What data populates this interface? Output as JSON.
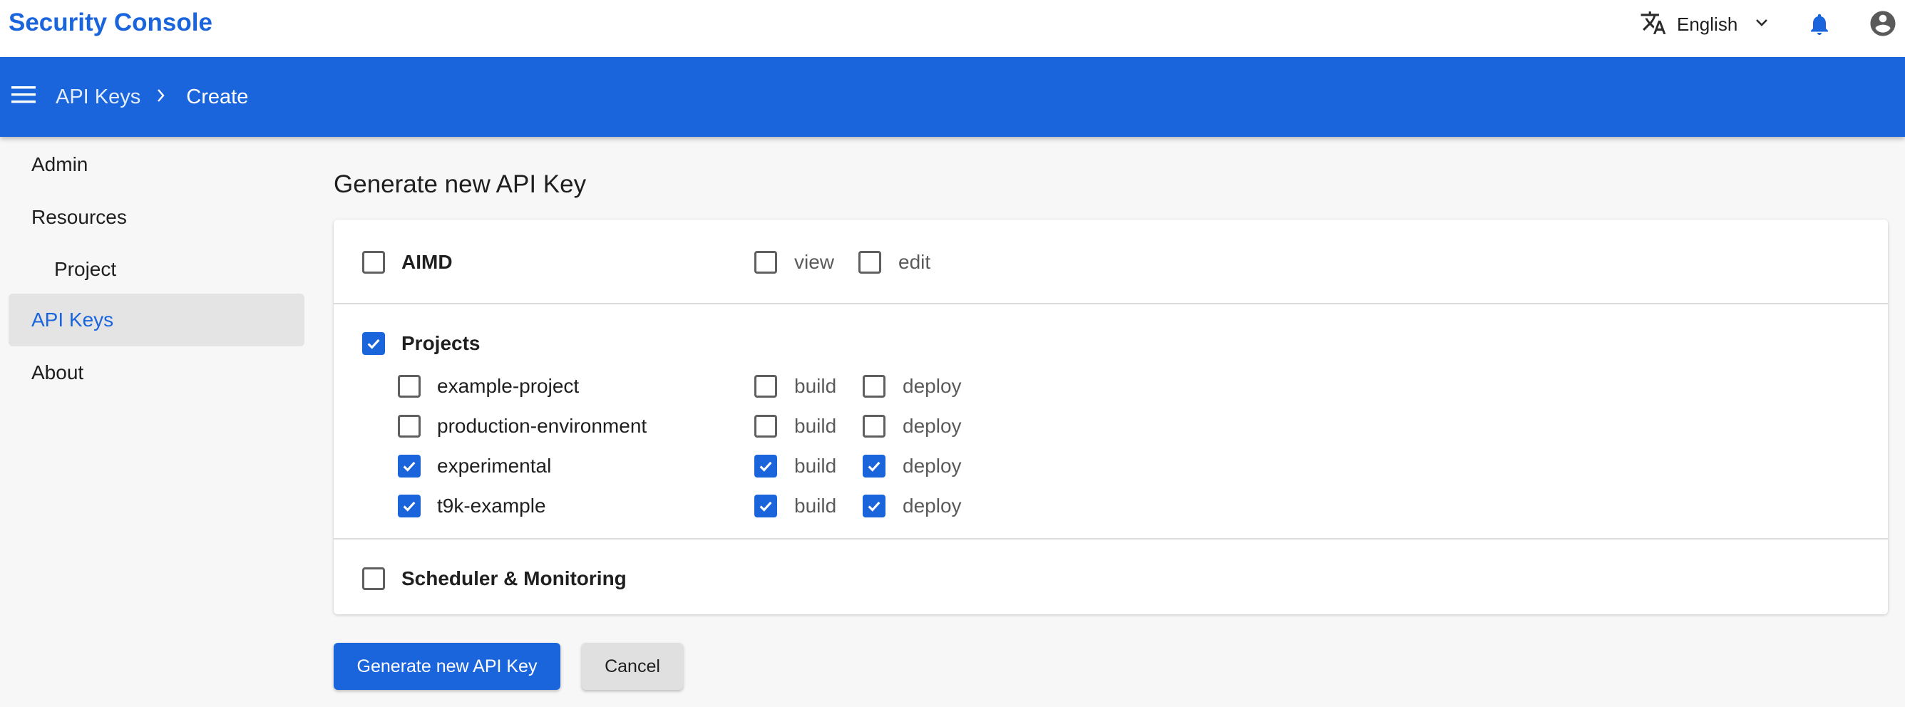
{
  "app": {
    "title": "Security Console"
  },
  "topbar": {
    "language_icon": "translate-icon",
    "language": "English",
    "language_chevron_icon": "chevron-down-icon",
    "notifications_icon": "bell-icon",
    "account_icon": "account-circle-icon"
  },
  "header": {
    "menu_icon": "hamburger-menu-icon",
    "breadcrumb": [
      "API Keys",
      "Create"
    ],
    "separator_icon": "chevron-right-icon"
  },
  "sidebar": {
    "items": [
      {
        "label": "Admin",
        "active": false
      },
      {
        "label": "Resources",
        "active": false
      },
      {
        "label": "Project",
        "active": false,
        "sub": true
      },
      {
        "label": "API Keys",
        "active": true
      },
      {
        "label": "About",
        "active": false
      }
    ]
  },
  "main": {
    "title": "Generate new API Key",
    "groups": {
      "aimd": {
        "label": "AIMD",
        "checked": false,
        "perms": [
          {
            "label": "view",
            "checked": false
          },
          {
            "label": "edit",
            "checked": false
          }
        ]
      },
      "projects": {
        "label": "Projects",
        "checked": true,
        "items": [
          {
            "label": "example-project",
            "checked": false,
            "build": "build",
            "build_checked": false,
            "deploy": "deploy",
            "deploy_checked": false
          },
          {
            "label": "production-environment",
            "checked": false,
            "build": "build",
            "build_checked": false,
            "deploy": "deploy",
            "deploy_checked": false
          },
          {
            "label": "experimental",
            "checked": true,
            "build": "build",
            "build_checked": true,
            "deploy": "deploy",
            "deploy_checked": true
          },
          {
            "label": "t9k-example",
            "checked": true,
            "build": "build",
            "build_checked": true,
            "deploy": "deploy",
            "deploy_checked": true
          }
        ]
      },
      "scheduler": {
        "label": "Scheduler & Monitoring",
        "checked": false
      }
    },
    "generate_label": "Generate new API Key",
    "cancel_label": "Cancel"
  },
  "colors": {
    "accent": "#1b65dc",
    "active_bg": "#e4e4e4",
    "page_bg": "#f7f7f7"
  }
}
